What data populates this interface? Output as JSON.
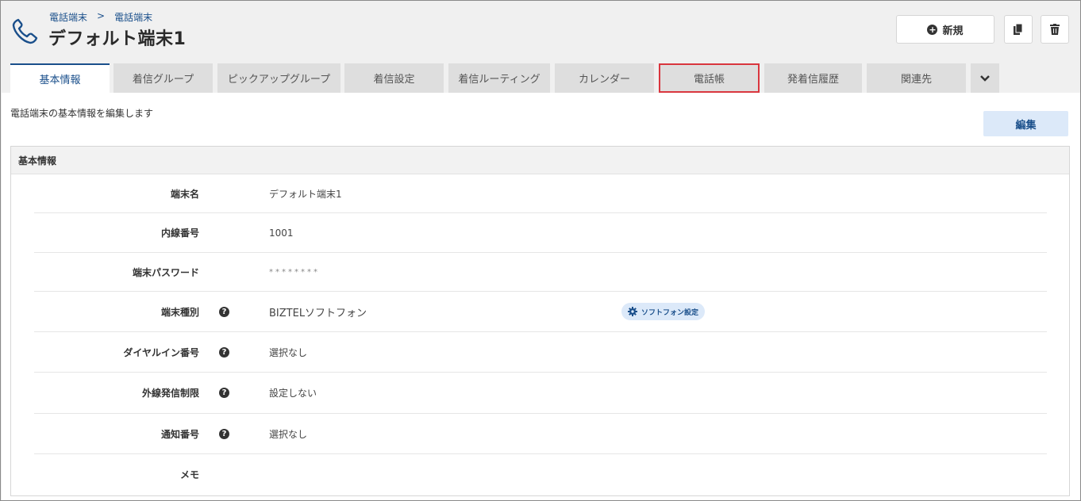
{
  "header": {
    "breadcrumb": [
      "電話端末",
      "電話端末"
    ],
    "breadcrumb_sep": ">",
    "title": "デフォルト端末1",
    "new_button_label": "新規",
    "copy_icon": "copy-icon",
    "delete_icon": "trash-icon"
  },
  "tabs": [
    {
      "label": "基本情報",
      "active": true
    },
    {
      "label": "着信グループ"
    },
    {
      "label": "ピックアップグループ"
    },
    {
      "label": "着信設定"
    },
    {
      "label": "着信ルーティング"
    },
    {
      "label": "カレンダー"
    },
    {
      "label": "電話帳",
      "highlighted": true
    },
    {
      "label": "発着信履歴"
    },
    {
      "label": "関連先"
    }
  ],
  "main": {
    "description": "電話端末の基本情報を編集します",
    "edit_button_label": "編集",
    "panel_title": "基本情報",
    "fields": [
      {
        "label": "端末名",
        "value": "デフォルト端末1"
      },
      {
        "label": "内線番号",
        "value": "1001"
      },
      {
        "label": "端末パスワード",
        "value": "********"
      },
      {
        "label": "端末種別",
        "value": "BIZTELソフトフォン",
        "help": "?",
        "action_label": "ソフトフォン設定"
      },
      {
        "label": "ダイヤルイン番号",
        "value": "選択なし",
        "help": "?"
      },
      {
        "label": "外線発信制限",
        "value": "設定しない",
        "help": "?"
      },
      {
        "label": "通知番号",
        "value": "選択なし",
        "help": "?"
      },
      {
        "label": "メモ",
        "value": ""
      }
    ]
  },
  "colors": {
    "accent": "#1a4f8b",
    "highlight": "#d9363e",
    "tab_bg": "#dedede"
  }
}
